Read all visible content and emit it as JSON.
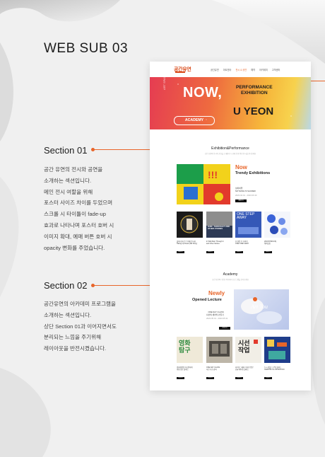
{
  "page": {
    "title": "WEB SUB 03"
  },
  "section1": {
    "heading": "Section 01",
    "lines": [
      "공간 유연의 전시와 공연을",
      "소개하는 섹션입니다.",
      "메인 전시 여할을 위해",
      "포스터 사이즈 차이를 두었으며",
      "스크롤 시 타이틀이 fade-up",
      "효과로 나타나며 포스터 호버 시",
      "이미지 확대, 예매 버튼 호버 시",
      "opacity 변화를 주었습니다."
    ]
  },
  "section2": {
    "heading": "Section 02",
    "lines": [
      "공간유연의 아카데미 프로그램을",
      "소개하는 섹션입니다.",
      "상단 Section 01과 이어지면서도",
      "분리되는 느낌을 주기위해",
      "레이아웃을 반전시켰습니다."
    ]
  },
  "mock": {
    "logo": "공간유연",
    "menu": [
      "공간유연",
      "아트앤사",
      "전시 & 공연",
      "예약",
      "아카데미",
      "고객센터"
    ],
    "hero": {
      "now": "NOW,",
      "performance": "PERFORMANCE",
      "exhibition": "EXHIBITION",
      "uyeon": "U YEON",
      "academy_badge": "ACADEMY",
      "vertical": "ART SPACE"
    },
    "exhibition": {
      "title": "Exhibition&Performance",
      "subtitle": "공간 유연의 전시와 공연을 소개합니다. 현재 진행 중인 전시를 만나보세요",
      "feature_title": "Now",
      "feature_sub": "Trendy Exhibitions",
      "feature_desc": "심야여행\nNOTHING IS SACRED",
      "feature_date": "2023.04.01 - 2023.06.30",
      "feature_btn": "예매하기",
      "items": [
        {
          "caption": "올해 기사로 더 이해 전시회\nTaking Up Room(Tall Story)",
          "btn": "예매하기",
          "poster": "room"
        },
        {
          "caption": "In Wild Ruin Through It\nand Other Stories",
          "btn": "예매하기",
          "poster": "ruin"
        },
        {
          "caption": "한 걸음 더 가까이\nONE STEP AWAY",
          "btn": "예매하기",
          "poster": "step"
        },
        {
          "caption": "[ANONYMOUS]\n제목없음",
          "btn": "예매하기",
          "poster": "anon"
        }
      ],
      "ruin_text": "RUIN - THROUGH IT AND OTHER STORIES",
      "step_text": "ONE STEP AWAY"
    },
    "academy": {
      "title": "Academy",
      "subtitle": "공간 유연의 다양한 아카데미 프로그램을 만나보세요",
      "feature_title": "Newly",
      "feature_sub": "Opened Lecture",
      "feature_desc": "ONE DAY CLASS\n나만의 세라믹 만들기",
      "feature_date": "2023.05.01 - 2023.05.31",
      "feature_btn": "신청하기",
      "art_text": "Art Tou",
      "items": [
        {
          "caption": "영화제작연구회 원데이\n영화 입문 클래스",
          "btn": "신청하기",
          "poster": "film"
        },
        {
          "caption": "ONE DAY CLASS\n사진 기초 강좌",
          "btn": "신청하기",
          "poster": "photo"
        },
        {
          "caption": "타이포그래피 디자인 입문\n한글 레터링 클래스",
          "btn": "신청하기",
          "poster": "type"
        },
        {
          "caption": "도시 관찰 드로잉 클래스\nGRAPHIC ILLUSTRATION",
          "btn": "신청하기",
          "poster": "city"
        }
      ],
      "film_text": "영화\n탐구",
      "type_text": "시선\n작업"
    }
  },
  "colors": {
    "accent": "#e8652a",
    "dark": "#111111",
    "background": "#eeeeee"
  }
}
